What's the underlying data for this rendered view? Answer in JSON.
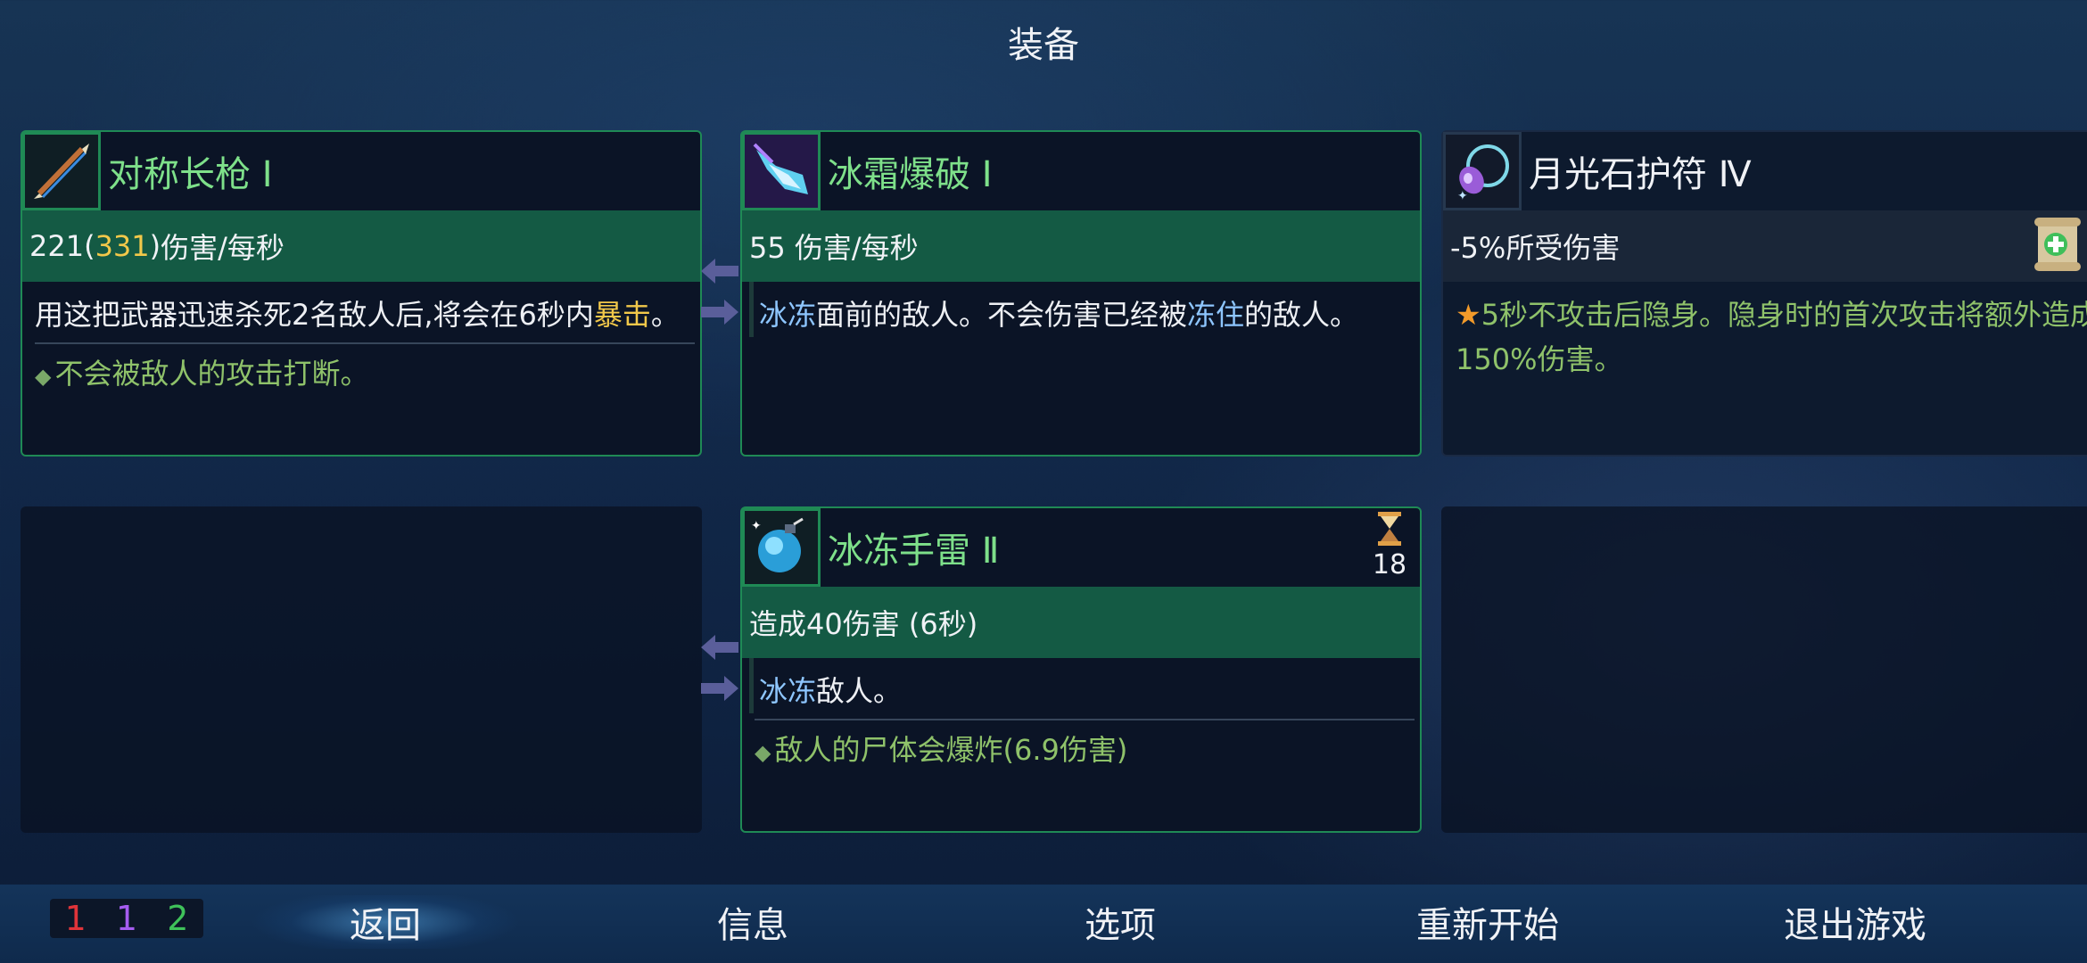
{
  "title": "装备",
  "cards": [
    {
      "name": "对称长枪 Ⅰ",
      "icon": "spear-icon",
      "stat_value": "221",
      "stat_paren_open": " (",
      "stat_bonus": "331",
      "stat_paren_close": ")",
      "stat_unit": " 伤害/每秒",
      "desc_main": "用这把武器迅速杀死2名敌人后,将会在6秒内",
      "desc_hl": "暴击",
      "desc_end": "。",
      "extra": "不会被敌人的攻击打断。"
    },
    {
      "name": "冰霜爆破 Ⅰ",
      "icon": "ice-blast-icon",
      "stat": "55 伤害/每秒",
      "desc_hl1": "冰冻",
      "desc_mid": "面前的敌人。不会伤害已经被",
      "desc_hl2": "冻住",
      "desc_end": "的敌人。"
    },
    {
      "name": "月光石护符 Ⅳ",
      "icon": "moonstone-amulet-icon",
      "stat": "-5%所受伤害",
      "scroll_count": "1",
      "desc": "5秒不攻击后隐身。隐身时的首次攻击将额外造成150%伤害。"
    },
    {
      "name": "冰冻手雷 Ⅱ",
      "icon": "ice-grenade-icon",
      "cooldown": "18",
      "stat": "造成40伤害 (6秒)",
      "desc_hl": "冰冻",
      "desc_end": "敌人。",
      "extra": "敌人的尸体会爆炸(6.9伤害)"
    }
  ],
  "scroll_counts": [
    "1",
    "1",
    "2"
  ],
  "scroll_colors": [
    "#e0343a",
    "#a55cf0",
    "#3fc25a"
  ],
  "menu": [
    "返回",
    "信息",
    "选项",
    "重新开始",
    "退出游戏"
  ]
}
